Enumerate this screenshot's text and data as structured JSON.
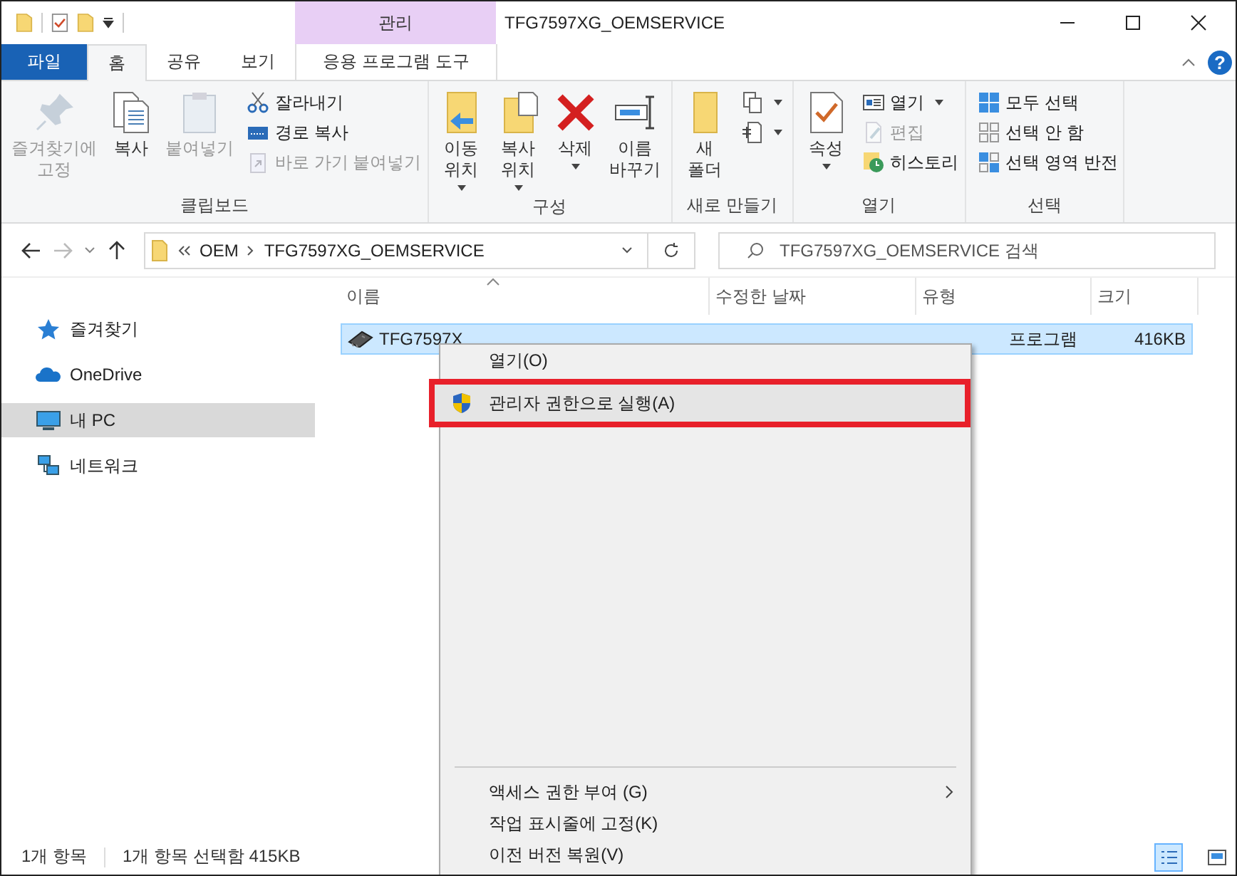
{
  "window": {
    "title": "TFG7597XG_OEMSERVICE",
    "context_group": "관리"
  },
  "tabs": [
    {
      "label": "파일",
      "kind": "file",
      "selected": false
    },
    {
      "label": "홈",
      "kind": "tab",
      "selected": true
    },
    {
      "label": "공유",
      "kind": "tab",
      "selected": false
    },
    {
      "label": "보기",
      "kind": "tab",
      "selected": false
    },
    {
      "label": "응용 프로그램 도구",
      "kind": "context",
      "selected": false
    }
  ],
  "help": "?",
  "ribbon": [
    {
      "label": "클립보드",
      "large": [
        {
          "lines": [
            "즐겨찾기에",
            "고정"
          ],
          "disabled": true,
          "dropdown": false
        },
        {
          "lines": [
            "복사"
          ],
          "disabled": false,
          "dropdown": false
        },
        {
          "lines": [
            "붙여넣기"
          ],
          "disabled": true,
          "dropdown": false
        }
      ],
      "small": [
        {
          "label": "잘라내기",
          "disabled": false,
          "dropdown": false
        },
        {
          "label": "경로 복사",
          "disabled": false,
          "dropdown": false
        },
        {
          "label": "바로 가기 붙여넣기",
          "disabled": true,
          "dropdown": false
        }
      ]
    },
    {
      "label": "구성",
      "large": [
        {
          "lines": [
            "이동",
            "위치"
          ],
          "disabled": false,
          "dropdown": true
        },
        {
          "lines": [
            "복사",
            "위치"
          ],
          "disabled": false,
          "dropdown": true
        },
        {
          "lines": [
            "삭제"
          ],
          "disabled": false,
          "dropdown": true
        },
        {
          "lines": [
            "이름",
            "바꾸기"
          ],
          "disabled": false,
          "dropdown": false
        }
      ]
    },
    {
      "label": "새로 만들기",
      "large": [
        {
          "lines": [
            "새",
            "폴더"
          ],
          "disabled": false,
          "dropdown": false
        }
      ],
      "small": [
        {
          "disabled": false,
          "dropdown": true
        },
        {
          "disabled": false,
          "dropdown": true
        }
      ]
    },
    {
      "label": "열기",
      "large": [
        {
          "lines": [
            "속성"
          ],
          "disabled": false,
          "dropdown": true
        }
      ],
      "small": [
        {
          "label": "열기",
          "disabled": false,
          "dropdown": true
        },
        {
          "label": "편집",
          "disabled": true,
          "dropdown": false
        },
        {
          "label": "히스토리",
          "disabled": false,
          "dropdown": false
        }
      ]
    },
    {
      "label": "선택",
      "small": [
        {
          "label": "모두 선택",
          "disabled": false,
          "dropdown": false
        },
        {
          "label": "선택 안 함",
          "disabled": false,
          "dropdown": false
        },
        {
          "label": "선택 영역 반전",
          "disabled": false,
          "dropdown": false
        }
      ]
    }
  ],
  "address": {
    "path": [
      "OEM",
      "TFG7597XG_OEMSERVICE"
    ]
  },
  "search": {
    "placeholder": "TFG7597XG_OEMSERVICE 검색"
  },
  "sidebar": {
    "items": [
      {
        "label": "즐겨찾기",
        "selected": false
      },
      {
        "label": "OneDrive",
        "selected": false
      },
      {
        "label": "내 PC",
        "selected": true
      },
      {
        "label": "네트워크",
        "selected": false
      }
    ]
  },
  "table": {
    "columns": [
      "이름",
      "수정한 날짜",
      "유형",
      "크기"
    ],
    "rows": [
      {
        "name": "TFG7597X",
        "type": "프로그램",
        "size": "416KB",
        "selected": true
      }
    ]
  },
  "context_menu": {
    "items": [
      {
        "label": "열기(O)",
        "highlighted": false
      },
      {
        "label": "관리자 권한으로 실행(A)",
        "highlighted": true
      }
    ],
    "bottom_items": [
      {
        "label": "액세스 권한 부여 (G)",
        "highlighted": false,
        "submenu": true
      },
      {
        "label": "작업 표시줄에 고정(K)",
        "highlighted": false,
        "submenu": false
      },
      {
        "label": "이전 버전 복원(V)",
        "highlighted": false,
        "submenu": false
      }
    ]
  },
  "status_bar": {
    "count": "1개 항목",
    "selection": "1개 항목 선택함 415KB",
    "views": [
      {
        "kind": "details",
        "selected": true
      },
      {
        "kind": "large",
        "selected": false
      }
    ]
  }
}
